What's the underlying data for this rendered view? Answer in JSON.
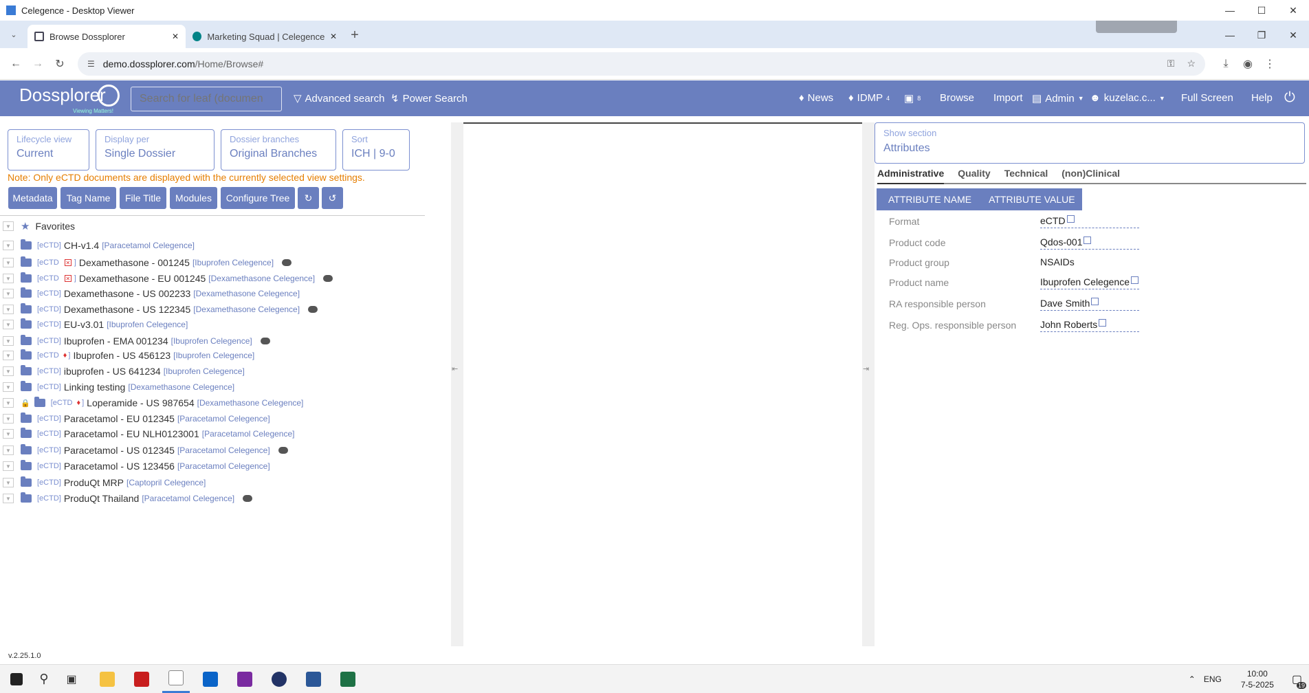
{
  "window": {
    "title": "Celegence - Desktop Viewer"
  },
  "browser": {
    "tabs": [
      {
        "label": "Browse Dossplorer",
        "active": true
      },
      {
        "label": "Marketing Squad | Celegence -",
        "active": false
      }
    ],
    "url_host": "demo.dossplorer.com",
    "url_path": "/Home/Browse#"
  },
  "app": {
    "logo": "Dossplorer",
    "logo_tagline": "Viewing Matters!",
    "search_placeholder": "Search for leaf (documen",
    "nav": {
      "advanced_search": "Advanced search",
      "power_search": "Power Search",
      "news": "News",
      "idmp": "IDMP",
      "idmp_count": "4",
      "lock_count": "8",
      "browse": "Browse",
      "import": "Import",
      "admin": "Admin",
      "user": "kuzelac.c...",
      "full_screen": "Full Screen",
      "help": "Help"
    }
  },
  "filters": {
    "lifecycle": {
      "label": "Lifecycle view",
      "value": "Current"
    },
    "display": {
      "label": "Display per",
      "value": "Single Dossier"
    },
    "branches": {
      "label": "Dossier branches",
      "value": "Original Branches"
    },
    "sort": {
      "label": "Sort",
      "value": "ICH | 9-0"
    }
  },
  "note": "Note: Only eCTD documents are displayed with the currently selected view settings.",
  "toolbar": {
    "metadata": "Metadata",
    "tag_name": "Tag Name",
    "file_title": "File Title",
    "modules": "Modules",
    "configure_tree": "Configure Tree"
  },
  "tree": {
    "favorites": "Favorites",
    "items": [
      {
        "tag": "[eCTD]",
        "name": "CH-v1.4",
        "product": "[Paracetamol Celegence]",
        "chat": false,
        "red": false,
        "bell": false,
        "lock": false
      },
      {
        "tag": "[eCTD",
        "name": "Dexamethasone - 001245",
        "product": "[Ibuprofen Celegence]",
        "chat": true,
        "red": true,
        "bell": false,
        "lock": false
      },
      {
        "tag": "[eCTD",
        "name": "Dexamethasone - EU 001245",
        "product": "[Dexamethasone Celegence]",
        "chat": true,
        "red": true,
        "bell": false,
        "lock": false
      },
      {
        "tag": "[eCTD]",
        "name": "Dexamethasone - US 002233",
        "product": "[Dexamethasone Celegence]",
        "chat": false,
        "red": false,
        "bell": false,
        "lock": false
      },
      {
        "tag": "[eCTD]",
        "name": "Dexamethasone - US 122345",
        "product": "[Dexamethasone Celegence]",
        "chat": true,
        "red": false,
        "bell": false,
        "lock": false
      },
      {
        "tag": "[eCTD]",
        "name": "EU-v3.01",
        "product": "[Ibuprofen Celegence]",
        "chat": false,
        "red": false,
        "bell": false,
        "lock": false
      },
      {
        "tag": "[eCTD]",
        "name": "Ibuprofen - EMA 001234",
        "product": "[Ibuprofen Celegence]",
        "chat": true,
        "red": false,
        "bell": false,
        "lock": false
      },
      {
        "tag": "[eCTD",
        "name": "Ibuprofen - US 456123",
        "product": "[Ibuprofen Celegence]",
        "chat": false,
        "red": false,
        "bell": true,
        "lock": false
      },
      {
        "tag": "[eCTD]",
        "name": "ibuprofen - US 641234",
        "product": "[Ibuprofen Celegence]",
        "chat": false,
        "red": false,
        "bell": false,
        "lock": false
      },
      {
        "tag": "[eCTD]",
        "name": "Linking testing",
        "product": "[Dexamethasone Celegence]",
        "chat": false,
        "red": false,
        "bell": false,
        "lock": false
      },
      {
        "tag": "[eCTD",
        "name": "Loperamide - US 987654",
        "product": "[Dexamethasone Celegence]",
        "chat": false,
        "red": false,
        "bell": true,
        "lock": true
      },
      {
        "tag": "[eCTD]",
        "name": "Paracetamol - EU 012345",
        "product": "[Paracetamol Celegence]",
        "chat": false,
        "red": false,
        "bell": false,
        "lock": false
      },
      {
        "tag": "[eCTD]",
        "name": "Paracetamol - EU NLH0123001",
        "product": "[Paracetamol Celegence]",
        "chat": false,
        "red": false,
        "bell": false,
        "lock": false
      },
      {
        "tag": "[eCTD]",
        "name": "Paracetamol - US 012345",
        "product": "[Paracetamol Celegence]",
        "chat": true,
        "red": false,
        "bell": false,
        "lock": false
      },
      {
        "tag": "[eCTD]",
        "name": "Paracetamol - US 123456",
        "product": "[Paracetamol Celegence]",
        "chat": false,
        "red": false,
        "bell": false,
        "lock": false
      },
      {
        "tag": "[eCTD]",
        "name": "ProduQt MRP",
        "product": "[Captopril Celegence]",
        "chat": false,
        "red": false,
        "bell": false,
        "lock": false
      },
      {
        "tag": "[eCTD]",
        "name": "ProduQt Thailand",
        "product": "[Paracetamol Celegence]",
        "chat": true,
        "red": false,
        "bell": false,
        "lock": false
      }
    ]
  },
  "right_panel": {
    "section_label": "Show section",
    "section_value": "Attributes",
    "tabs": [
      "Administrative",
      "Quality",
      "Technical",
      "(non)Clinical"
    ],
    "col_name": "ATTRIBUTE NAME",
    "col_value": "ATTRIBUTE VALUE",
    "rows": [
      {
        "name": "Format",
        "value": "eCTD",
        "editable": true
      },
      {
        "name": "Product code",
        "value": "Qdos-001",
        "editable": true
      },
      {
        "name": "Product group",
        "value": "NSAIDs",
        "editable": false
      },
      {
        "name": "Product name",
        "value": "Ibuprofen Celegence",
        "editable": true
      },
      {
        "name": "RA responsible person",
        "value": "Dave Smith",
        "editable": true
      },
      {
        "name": "Reg. Ops. responsible person",
        "value": "John Roberts",
        "editable": true
      }
    ]
  },
  "version": "v.2.25.1.0",
  "taskbar": {
    "lang": "ENG",
    "time": "10:00",
    "date": "7-5-2025",
    "notif_count": "19"
  },
  "colors": {
    "accent": "#6a7fbf",
    "note": "#e67e00"
  }
}
